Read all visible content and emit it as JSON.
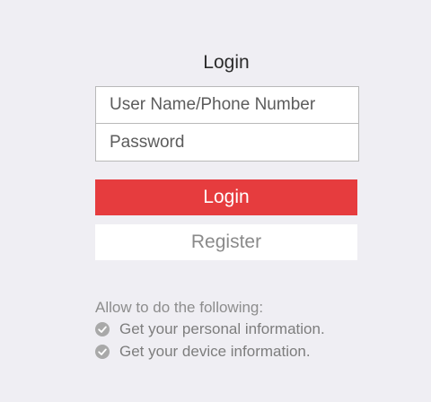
{
  "header": {
    "title": "Login"
  },
  "form": {
    "username_placeholder": "User Name/Phone Number",
    "username_value": "",
    "password_placeholder": "Password",
    "password_value": ""
  },
  "buttons": {
    "login_label": "Login",
    "register_label": "Register"
  },
  "permissions": {
    "heading": "Allow to do the following:",
    "items": [
      {
        "label": "Get your personal information.",
        "icon": "check-circle-icon"
      },
      {
        "label": "Get your device information.",
        "icon": "check-circle-icon"
      }
    ]
  },
  "colors": {
    "background": "#efeef3",
    "login_button": "#e63c3e",
    "register_button": "#ffffff"
  }
}
